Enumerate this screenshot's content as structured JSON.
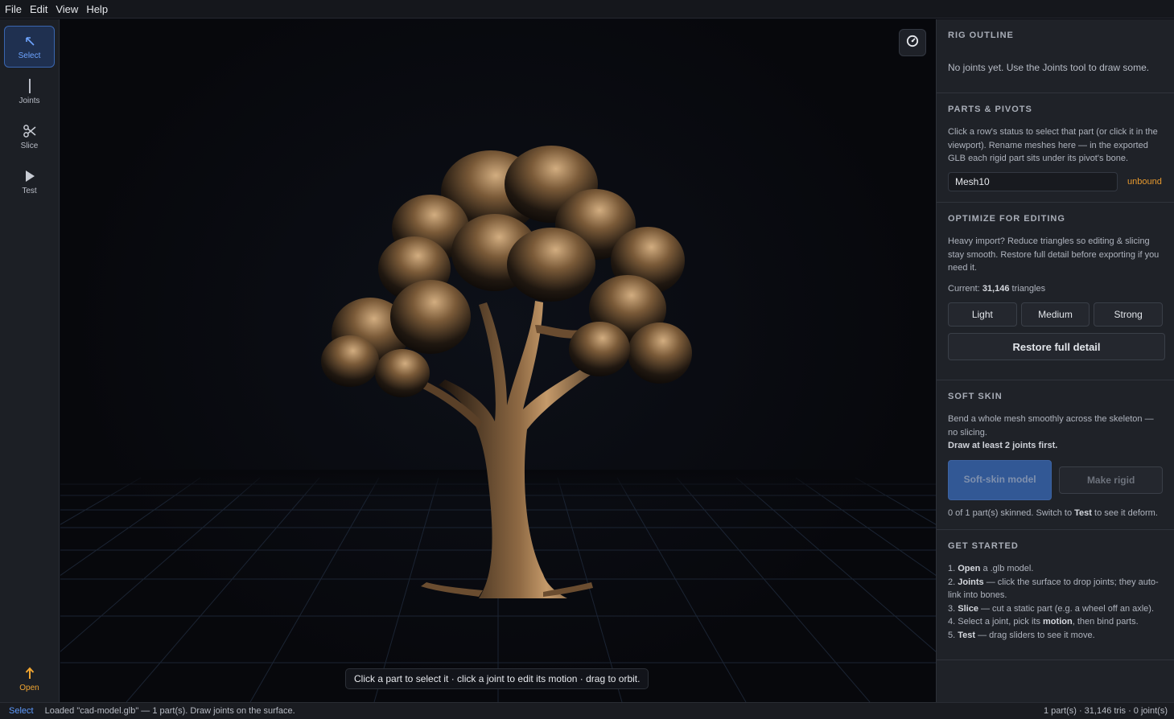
{
  "menu": [
    "File",
    "Edit",
    "View",
    "Help"
  ],
  "tools": {
    "select": "Select",
    "joints": "Joints",
    "slice": "Slice",
    "test": "Test",
    "open": "Open"
  },
  "viewport": {
    "hint": "Click a part to select it · click a joint to edit its motion · drag to orbit."
  },
  "rig": {
    "title": "RIG OUTLINE",
    "empty": "No joints yet. Use the Joints tool to draw some."
  },
  "parts": {
    "title": "PARTS & PIVOTS",
    "desc": "Click a row's status to select that part (or click it in the viewport). Rename meshes here — in the exported GLB each rigid part sits under its pivot's bone.",
    "mesh_name": "Mesh10",
    "mesh_status": "unbound"
  },
  "optimize": {
    "title": "OPTIMIZE FOR EDITING",
    "desc": "Heavy import? Reduce triangles so editing & slicing stay smooth. Restore full detail before exporting if you need it.",
    "current_label": "Current:",
    "current_count": "31,146",
    "current_unit": "triangles",
    "light": "Light",
    "medium": "Medium",
    "strong": "Strong",
    "restore": "Restore full detail"
  },
  "soft_skin": {
    "title": "SOFT SKIN",
    "desc": "Bend a whole mesh smoothly across the skeleton — no slicing.",
    "warning": "Draw at least 2 joints first.",
    "soft_skin_btn": "Soft-skin model",
    "make_rigid_btn": "Make rigid",
    "status_prefix": "0 of 1 part(s) skinned. Switch to",
    "status_bold": "Test",
    "status_suffix": "to see it deform."
  },
  "get_started": {
    "title": "GET STARTED",
    "steps": [
      {
        "num": "1.",
        "bold": "Open",
        "text": "a .glb model."
      },
      {
        "num": "2.",
        "bold": "Joints",
        "text": "— click the surface to drop joints; they auto-link into bones."
      },
      {
        "num": "3.",
        "bold": "Slice",
        "text": "— cut a static part (e.g. a wheel off an axle)."
      },
      {
        "num": "4.",
        "pre": "Select a joint, pick its",
        "bold": "motion",
        "text": ", then bind parts."
      },
      {
        "num": "5.",
        "bold": "Test",
        "text": "— drag sliders to see it move."
      }
    ]
  },
  "status": {
    "mode": "Select",
    "message": "Loaded \"cad-model.glb\" — 1 part(s). Draw joints on the surface.",
    "summary": "1 part(s) · 31,146 tris · 0 joint(s)"
  },
  "colors": {
    "accent": "#3b6fc4",
    "active_tool": "#6ea4ff",
    "warning": "#e89a2e",
    "bronze": "#a9855a"
  },
  "icons": {
    "select": "arrow-up-left-icon",
    "joints": "vertical-bar-icon",
    "slice": "scissors-icon",
    "test": "play-icon",
    "open": "upload-arrow-icon",
    "gauge": "gauge-icon"
  }
}
